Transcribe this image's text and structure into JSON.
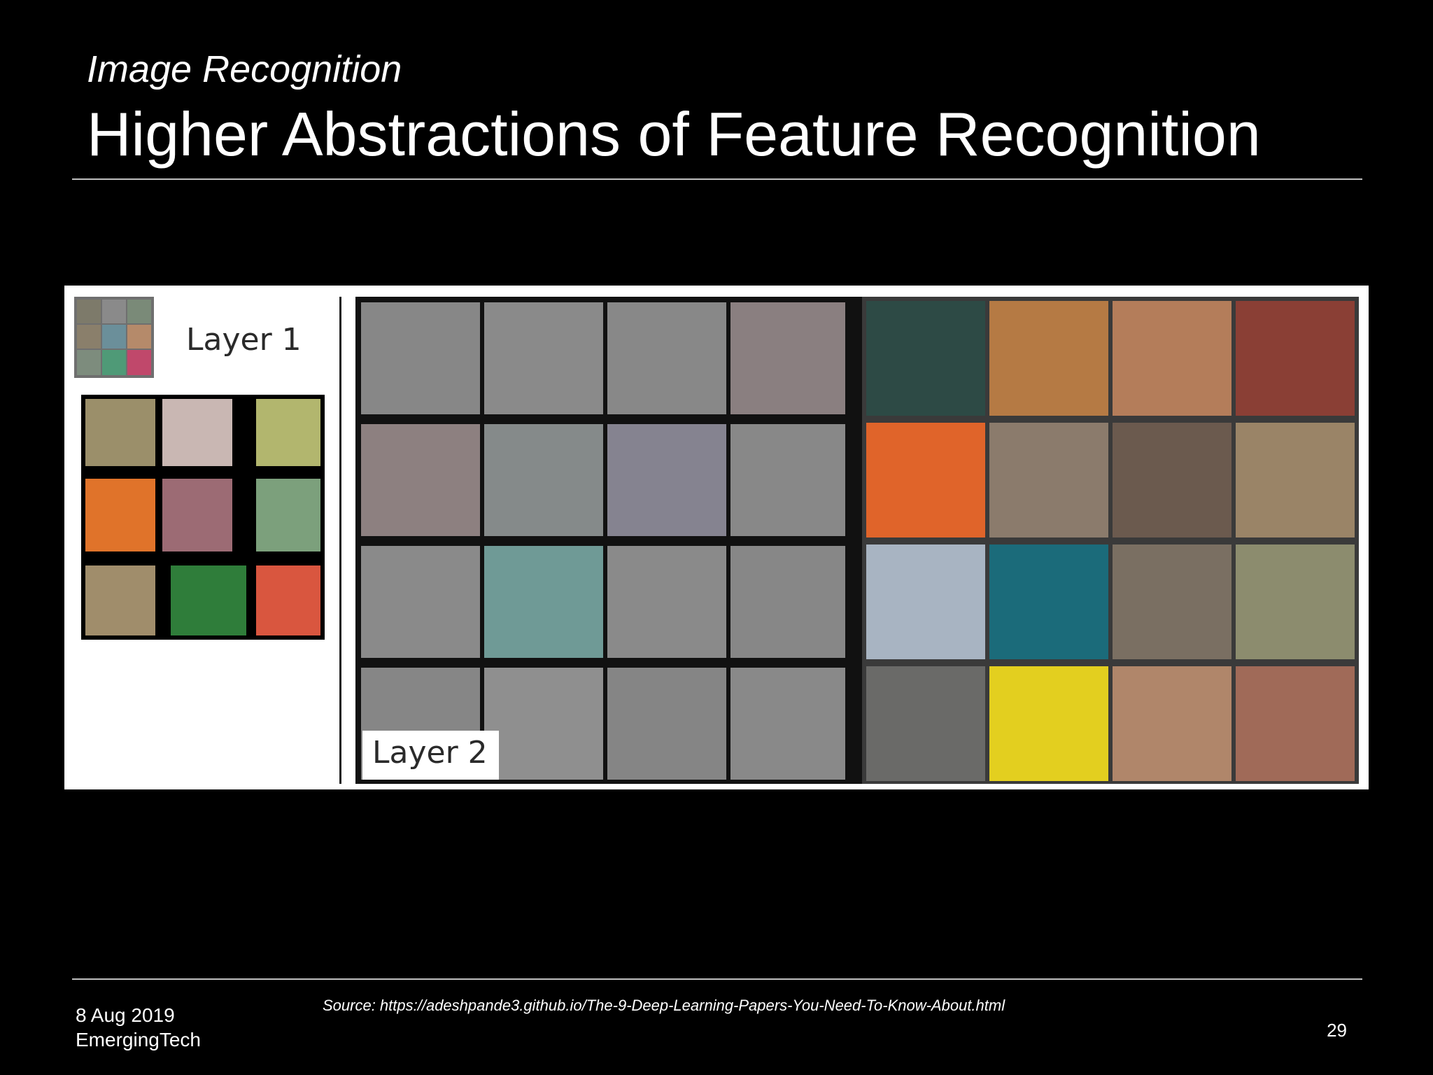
{
  "slide": {
    "subtitle": "Image Recognition",
    "title": "Higher Abstractions of Feature Recognition",
    "figure": {
      "layer1_label": "Layer 1",
      "layer2_label": "Layer 2"
    },
    "source": "Source: https://adeshpande3.github.io/The-9-Deep-Learning-Papers-You-Need-To-Know-About.html",
    "footer": {
      "date": "8 Aug 2019",
      "organization": "EmergingTech",
      "page_number": "29"
    }
  },
  "colors": {
    "background": "#000000",
    "text": "#ffffff",
    "rule": "#bfbfbf",
    "figure_background": "#ffffff",
    "filter_gray": "#8a8a8a"
  }
}
